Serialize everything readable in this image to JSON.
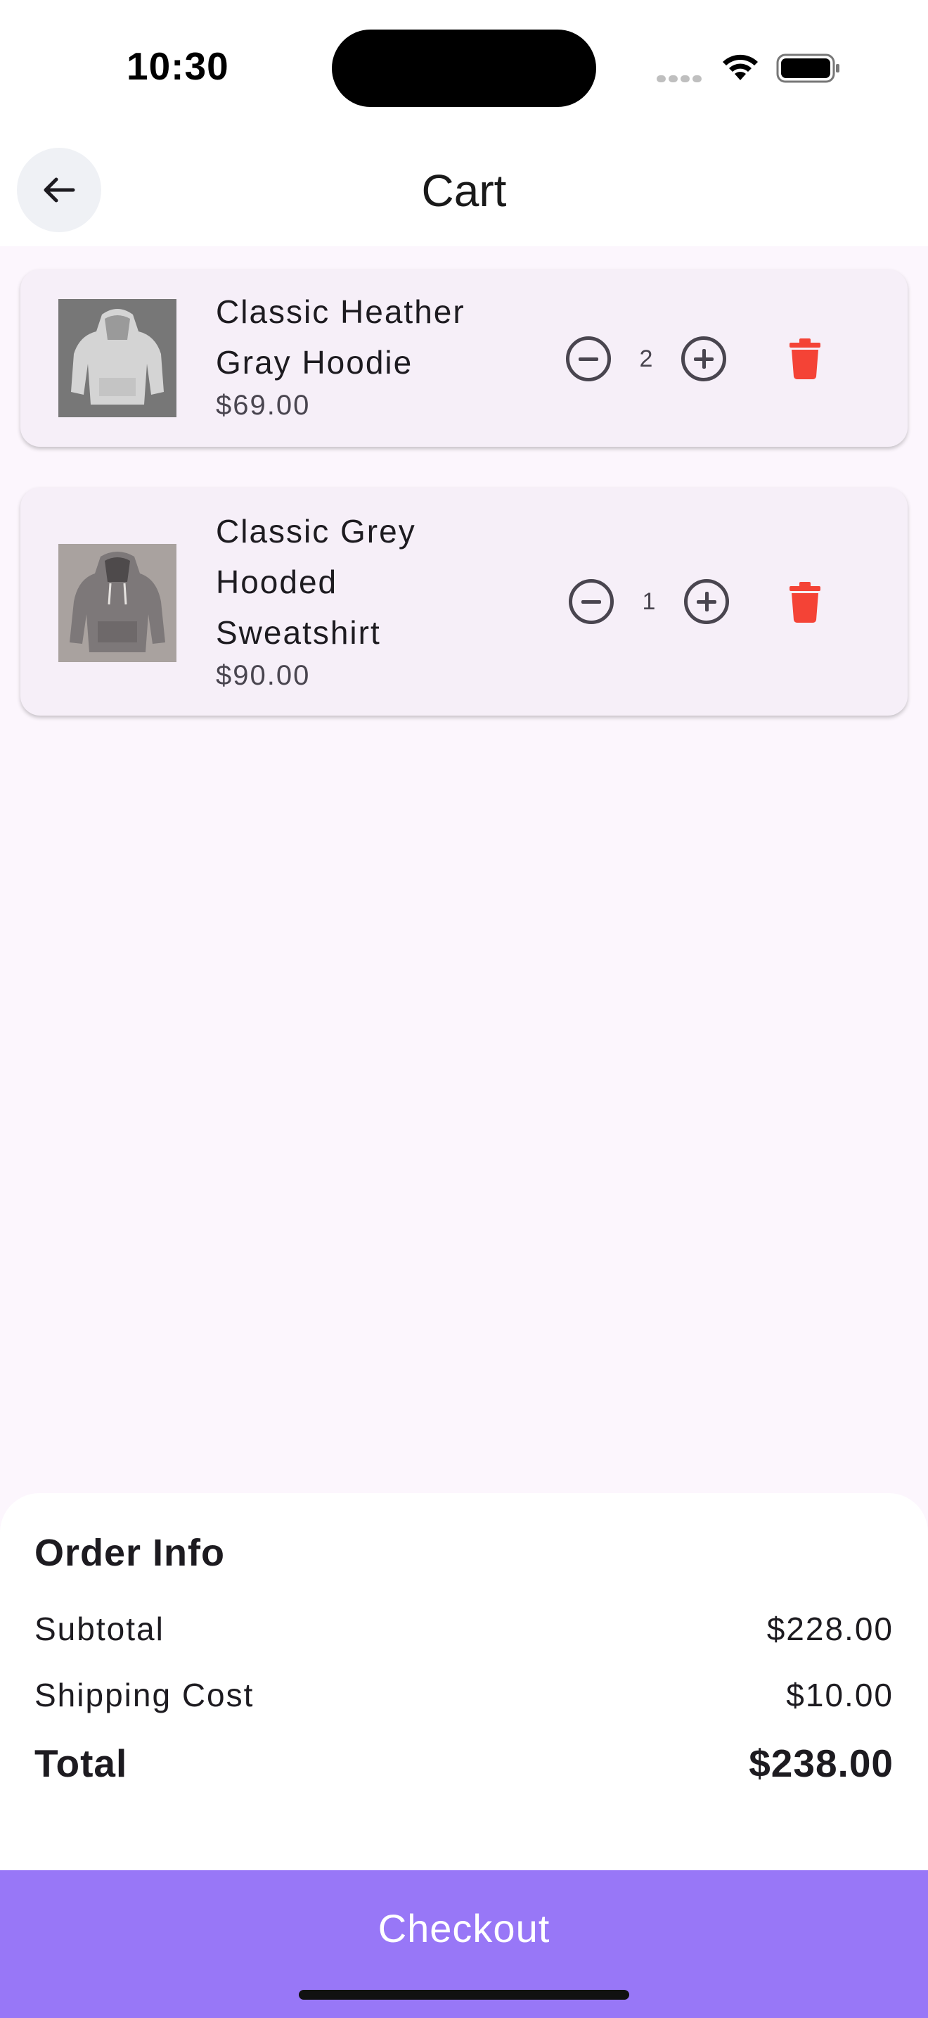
{
  "status_bar": {
    "time": "10:30"
  },
  "header": {
    "title": "Cart",
    "back_icon": "arrow-left-icon"
  },
  "cart": {
    "items": [
      {
        "name_line1": "Classic Heather",
        "name_line2": "Gray Hoodie",
        "price": "$69.00",
        "quantity": "2"
      },
      {
        "name_line1": "Classic Grey",
        "name_line2": "Hooded",
        "name_line3": "Sweatshirt",
        "price": "$90.00",
        "quantity": "1"
      }
    ]
  },
  "order_info": {
    "title": "Order Info",
    "subtotal_label": "Subtotal",
    "subtotal_value": "$228.00",
    "shipping_label": "Shipping Cost",
    "shipping_value": "$10.00",
    "total_label": "Total",
    "total_value": "$238.00"
  },
  "checkout": {
    "label": "Checkout"
  },
  "colors": {
    "accent": "#9877f7",
    "delete": "#f44336",
    "background": "#fcf6fd",
    "card": "#f6eff8"
  }
}
